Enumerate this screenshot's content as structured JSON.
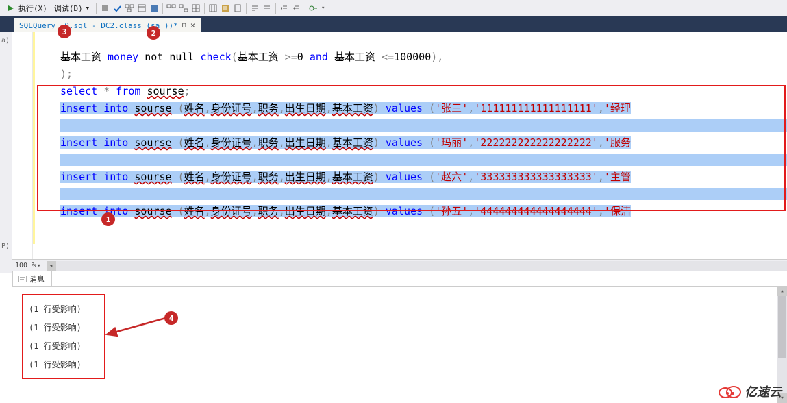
{
  "toolbar": {
    "execute": "执行(X)",
    "debug": "调试(D)"
  },
  "tab": {
    "title": "SQLQuery .0.sql - DC2.class (sa     ))*"
  },
  "code": {
    "pre1_a": "基本工资 ",
    "pre1_money": "money",
    "pre1_b": " not null ",
    "pre1_check": "check",
    "pre1_c": "(基本工资 >=0 ",
    "pre1_and": "and",
    "pre1_d": " 基本工资 <=100000),",
    "pre2": ");",
    "sel_select": "select",
    "sel_star": " * ",
    "sel_from": "from",
    "sel_tbl": " sourse;",
    "ins": "insert",
    "into": "into",
    "tbl": "sourse",
    "cols": "姓名",
    "col2": "身份证号",
    "col3": "职务",
    "col4": "出生日期",
    "col5": "基本工资",
    "values": "values",
    "r1_a": "张三",
    "r1_b": "111111111111111111",
    "r1_c": "经理",
    "r2_a": "玛丽",
    "r2_b": "222222222222222222",
    "r2_c": "服务",
    "r3_a": "赵六",
    "r3_b": "333333333333333333",
    "r3_c": "主管",
    "r4_a": "孙五",
    "r4_b": "444444444444444444",
    "r4_c": "保洁"
  },
  "zoom": "100 %",
  "msg_tab": "消息",
  "messages": {
    "line": "(1 行受影响)"
  },
  "badges": {
    "b1": "1",
    "b2": "2",
    "b3": "3",
    "b4": "4"
  },
  "watermark": "亿速云"
}
